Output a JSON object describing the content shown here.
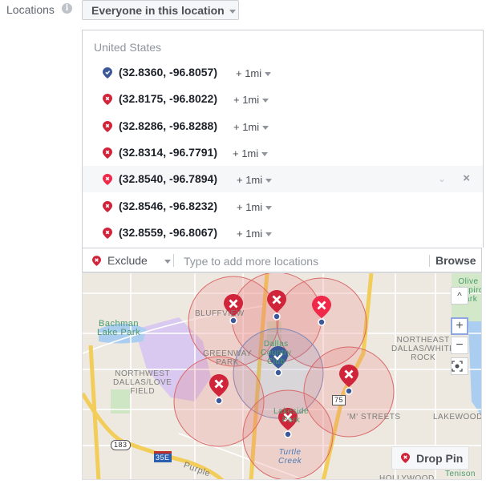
{
  "header": {
    "label": "Locations",
    "info_icon": "info-icon",
    "audience_select": "Everyone in this location"
  },
  "list": {
    "country": "United States",
    "locations": [
      {
        "coord": "(32.8360, -96.8057)",
        "radius": "+ 1mi",
        "type": "include",
        "icon": "include-pin-icon"
      },
      {
        "coord": "(32.8175, -96.8022)",
        "radius": "+ 1mi",
        "type": "exclude",
        "icon": "exclude-pin-icon"
      },
      {
        "coord": "(32.8286, -96.8288)",
        "radius": "+ 1mi",
        "type": "exclude",
        "icon": "exclude-pin-icon"
      },
      {
        "coord": "(32.8314, -96.7791)",
        "radius": "+ 1mi",
        "type": "exclude",
        "icon": "exclude-pin-icon"
      },
      {
        "coord": "(32.8540, -96.7894)",
        "radius": "+ 1mi",
        "type": "exclude",
        "icon": "exclude-pin-icon",
        "hovered": true
      },
      {
        "coord": "(32.8546, -96.8232)",
        "radius": "+ 1mi",
        "type": "exclude",
        "icon": "exclude-pin-icon"
      },
      {
        "coord": "(32.8559, -96.8067)",
        "radius": "+ 1mi",
        "type": "exclude",
        "icon": "exclude-pin-icon"
      }
    ],
    "row_actions": {
      "expand_icon": "chevron-down-icon",
      "remove_icon": "close-icon"
    }
  },
  "input_bar": {
    "mode": "Exclude",
    "placeholder": "Type to add more locations",
    "value": "",
    "browse": "Browse"
  },
  "map": {
    "labels": {
      "bluffview": "BLUFFVIEW",
      "bachman": "Bachman\nLake Park",
      "greenway": "GREENWAY\nPARK",
      "dallas_cc": "Dallas\nCountry\nClub",
      "northwest": "NORTHWEST\nDALLAS/LOVE\nFIELD",
      "northeast": "NORTHEAST\nDALLAS/WHITE\nROCK",
      "lakeside": "Lakeside\nPark",
      "m_streets": "'M' STREETS",
      "lakewood": "LAKEWOOD",
      "turtle_creek": "Turtle\nCreek",
      "purple": "Purple",
      "olive": "Olive\nShapiro\nPark",
      "tenison": "Tenison",
      "hollywood": "HOLLYWOOD",
      "lakewood2": "LAKEWOOD",
      "hwy183": "183",
      "hwy35e": "35E",
      "hwy75": "75"
    },
    "controls": {
      "collapse": "^",
      "zoom_in": "+",
      "zoom_out": "−"
    },
    "drop_pin": "Drop Pin",
    "colors": {
      "exclude": "#d0243a",
      "exclude_bright": "#f02849",
      "include": "#3b5998",
      "circle_fill": "#e89a9a"
    }
  }
}
